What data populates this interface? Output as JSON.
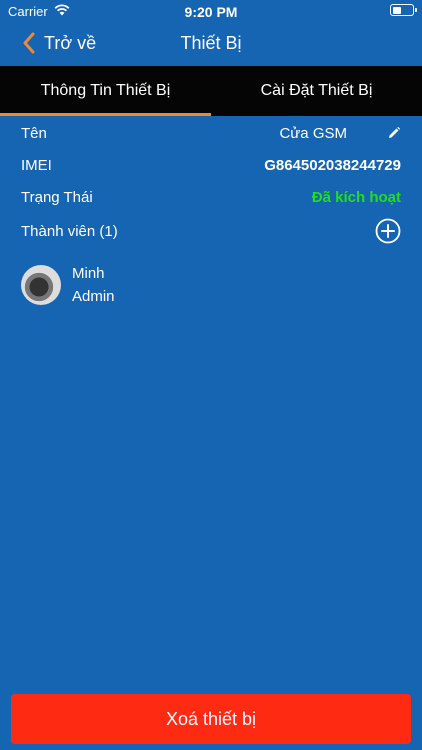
{
  "status_bar": {
    "carrier": "Carrier",
    "time": "9:20 PM"
  },
  "nav": {
    "back_label": "Trở về",
    "title": "Thiết Bị"
  },
  "tabs": [
    {
      "label": "Thông Tin Thiết Bị",
      "active": true
    },
    {
      "label": "Cài Đặt Thiết Bị",
      "active": false
    }
  ],
  "info": {
    "name_label": "Tên",
    "name_value": "Cửa GSM",
    "imei_label": "IMEI",
    "imei_value": "G864502038244729",
    "status_label": "Trạng Thái",
    "status_value": "Đã kích hoạt",
    "members_label": "Thành viên (1)"
  },
  "members": [
    {
      "name": "Minh",
      "role": "Admin"
    }
  ],
  "actions": {
    "delete_label": "Xoá thiết bị"
  },
  "colors": {
    "background": "#1565b3",
    "tab_bar": "#050505",
    "tab_indicator": "#e98a3b",
    "back_chevron": "#e98a3b",
    "status_active": "#22dd22",
    "delete_button": "#ff2a12"
  },
  "icons": [
    "wifi-icon",
    "battery-icon",
    "back-chevron-icon",
    "edit-icon",
    "add-circle-icon"
  ]
}
